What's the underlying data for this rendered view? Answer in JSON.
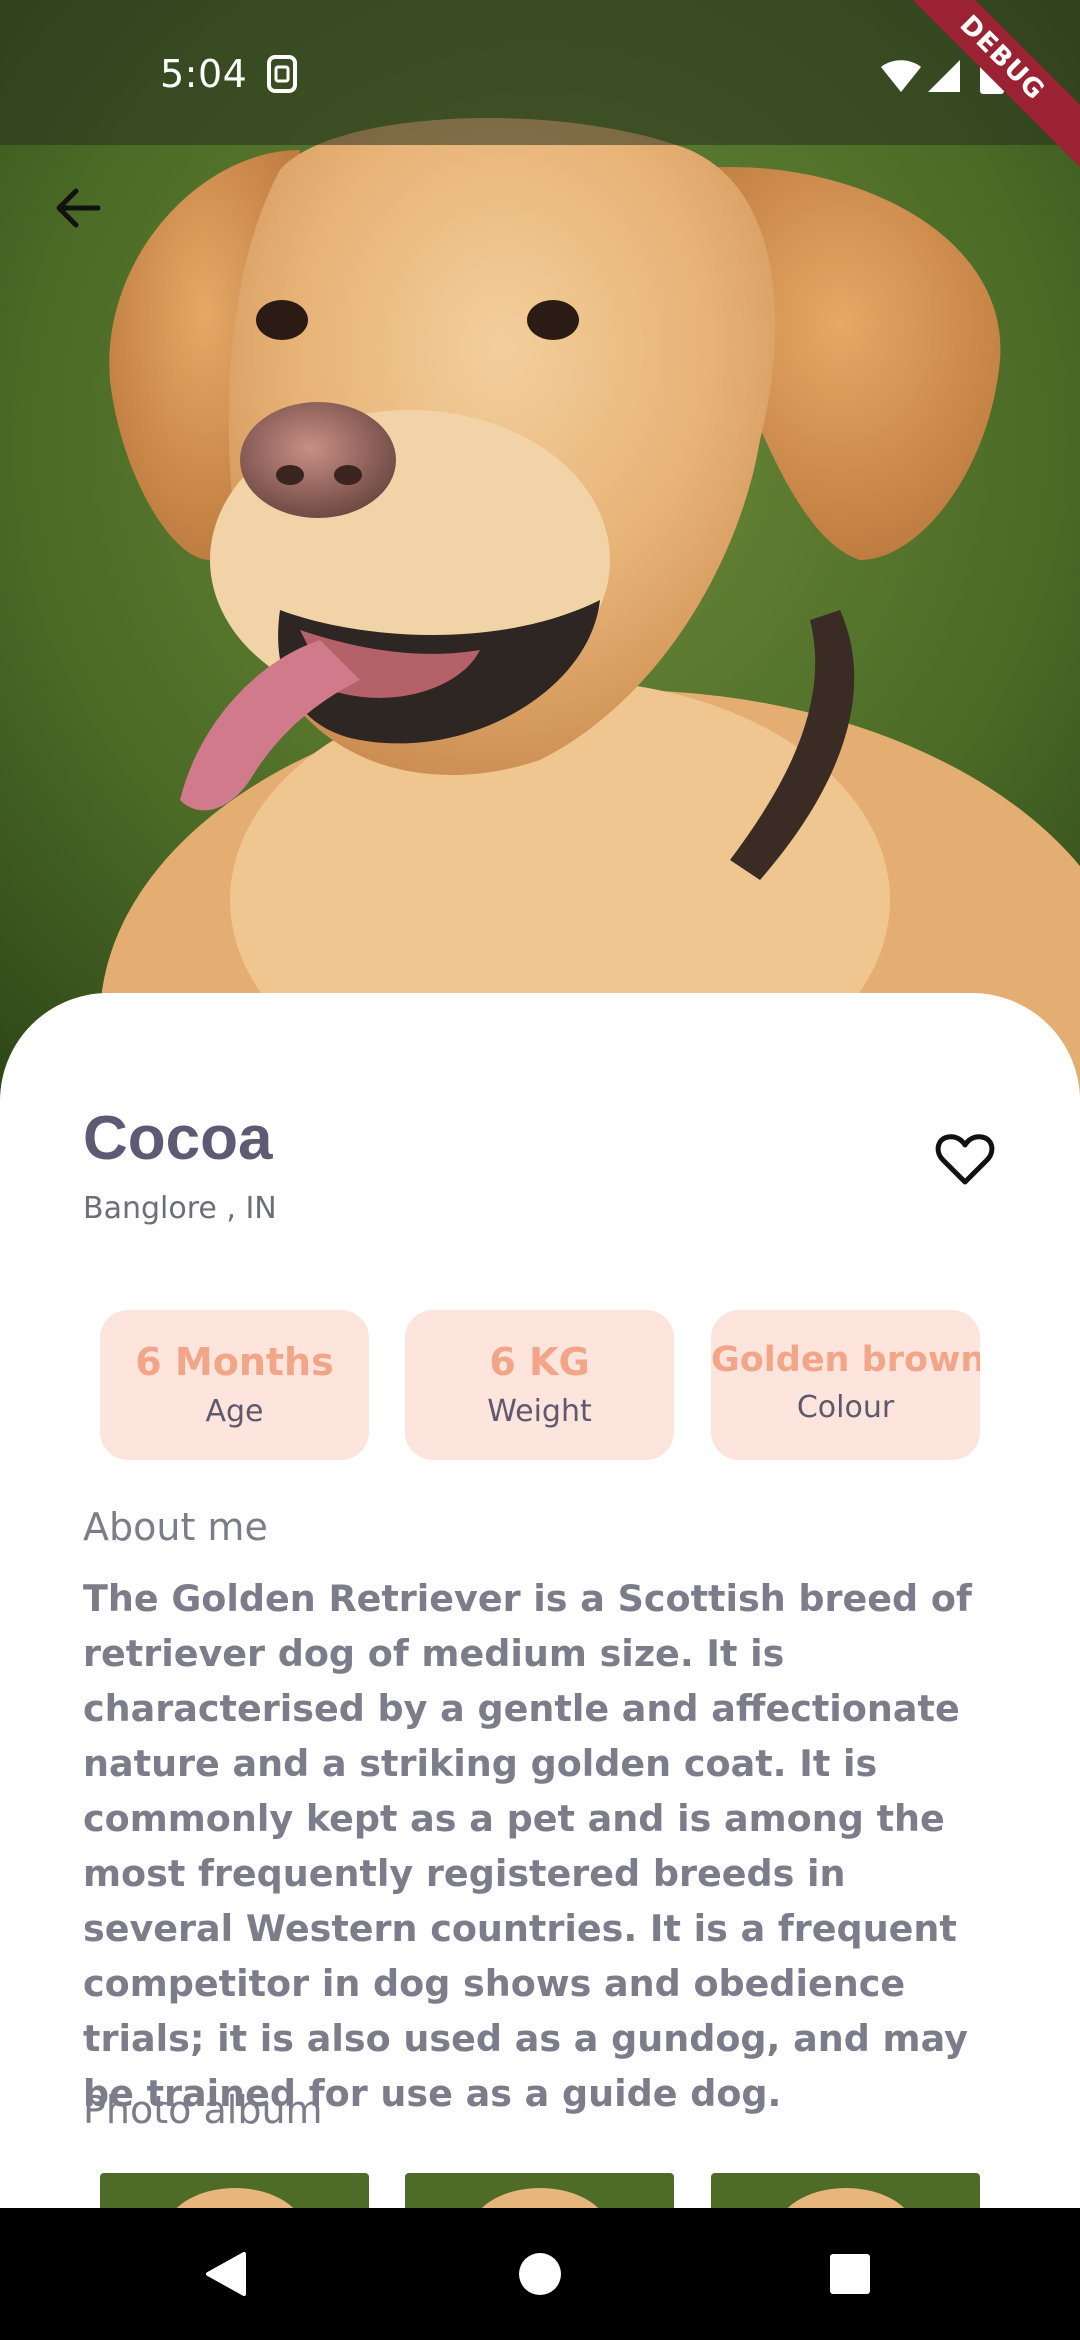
{
  "status_bar": {
    "time": "5:04",
    "sim_icon": "sim-card-icon",
    "wifi_icon": "wifi-icon",
    "signal_icon": "cellular-signal-icon",
    "battery_icon": "battery-icon"
  },
  "debug_banner": "DEBUG",
  "header": {
    "back_icon": "arrow-back-icon",
    "hero_image": "golden-retriever-photo"
  },
  "pet": {
    "name": "Cocoa",
    "location": "Banglore , IN",
    "favorite_icon": "heart-outline-icon"
  },
  "stats": [
    {
      "value": "6 Months",
      "label": "Age"
    },
    {
      "value": "6 KG",
      "label": "Weight"
    },
    {
      "value": "Golden brown",
      "label": "Colour"
    }
  ],
  "about": {
    "heading": "About me",
    "text": "The Golden Retriever is a Scottish breed of retriever dog of medium size. It is characterised by a gentle and affectionate nature and a striking golden coat. It is commonly kept as a pet and is among the most frequently registered breeds in several Western countries. It is a frequent competitor in dog shows and obedience trials; it is also used as a gundog, and may be trained for use as a guide dog."
  },
  "album": {
    "heading": "Photo album",
    "photo_count": 3
  },
  "nav_bar": {
    "back_icon": "triangle-back-icon",
    "home_icon": "circle-home-icon",
    "recents_icon": "square-recents-icon"
  },
  "colors": {
    "title": "#5e5a73",
    "stat_bg": "#fde5de",
    "stat_value": "#f2a687",
    "body_text": "#7d7c8a",
    "debug_banner": "#9b2233"
  }
}
